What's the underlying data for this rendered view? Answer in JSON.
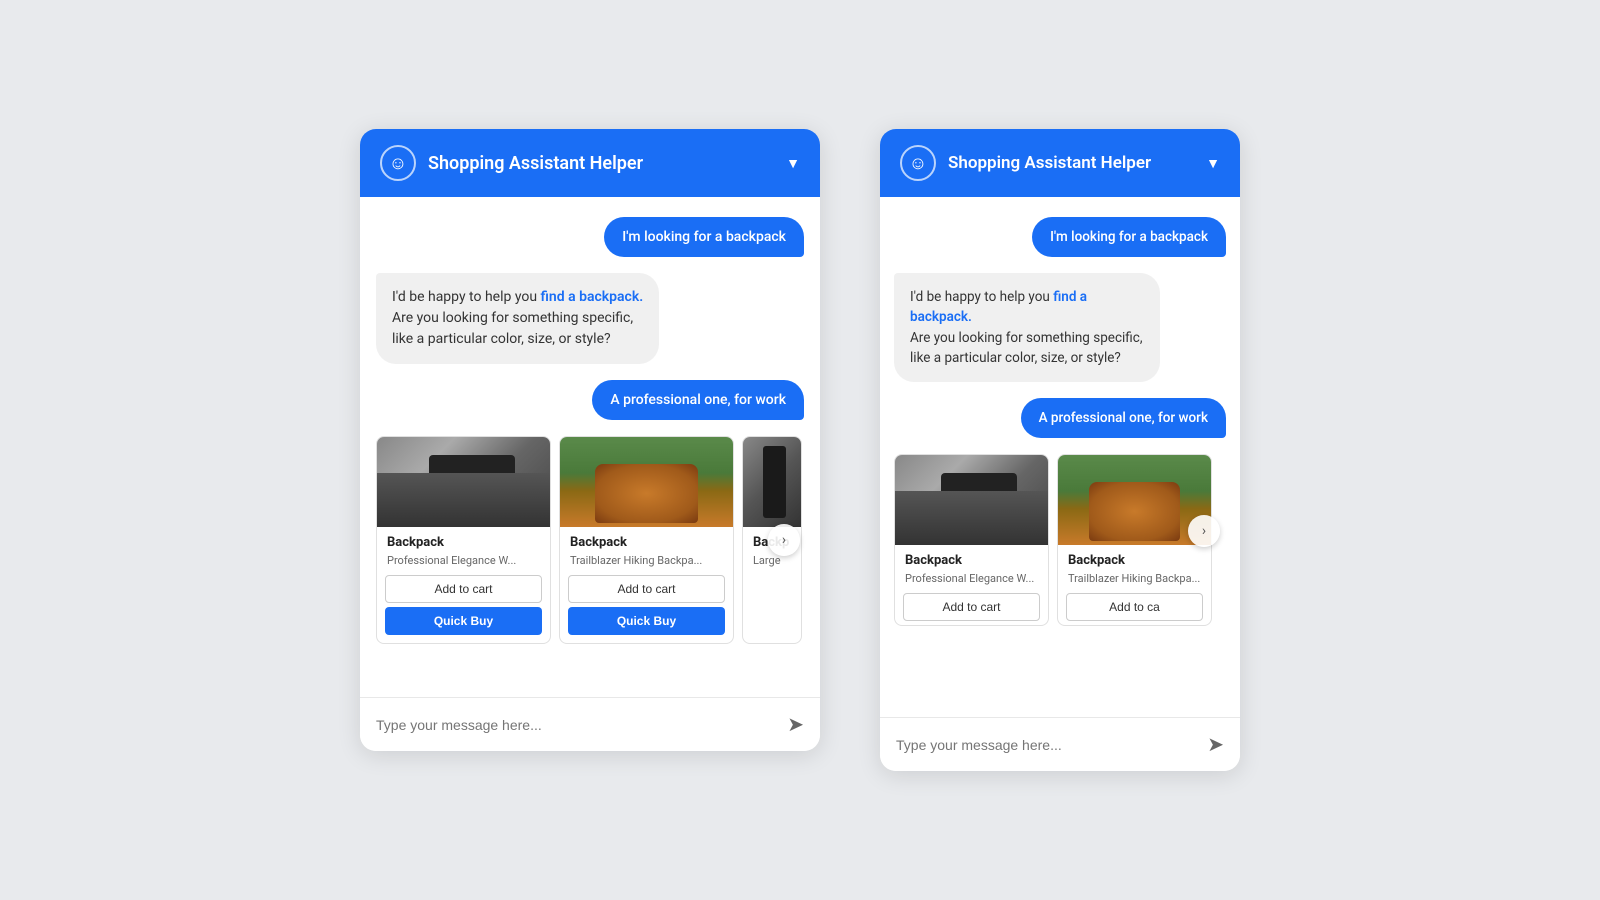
{
  "header": {
    "title": "Shopping Assistant Helper",
    "icon": "☺",
    "chevron": "▼"
  },
  "messages": [
    {
      "type": "user",
      "text": "I'm looking for a backpack"
    },
    {
      "type": "bot",
      "text_parts": [
        "I'd be happy to help you ",
        "find a backpack.",
        "\nAre you looking for something specific,\nlike a particular color, size, or style?"
      ],
      "highlight_word": "find a backpack."
    },
    {
      "type": "user",
      "text": "A professional one, for work"
    }
  ],
  "products": [
    {
      "name": "Backpack",
      "desc": "Professional Elegance W...",
      "size": "",
      "img_class": "img-backpack1",
      "add_to_cart": "Add to cart",
      "quick_buy": "Quick Buy"
    },
    {
      "name": "Backpack",
      "desc": "Trailblazer Hiking Backpa...",
      "size": "",
      "img_class": "img-backpack2",
      "add_to_cart": "Add to cart",
      "quick_buy": "Quick Buy"
    },
    {
      "name": "Backp",
      "desc": "Large",
      "size": "",
      "img_class": "img-backpack3",
      "add_to_cart": "",
      "quick_buy": ""
    }
  ],
  "input": {
    "placeholder": "Type your message here..."
  },
  "send_icon": "➤"
}
